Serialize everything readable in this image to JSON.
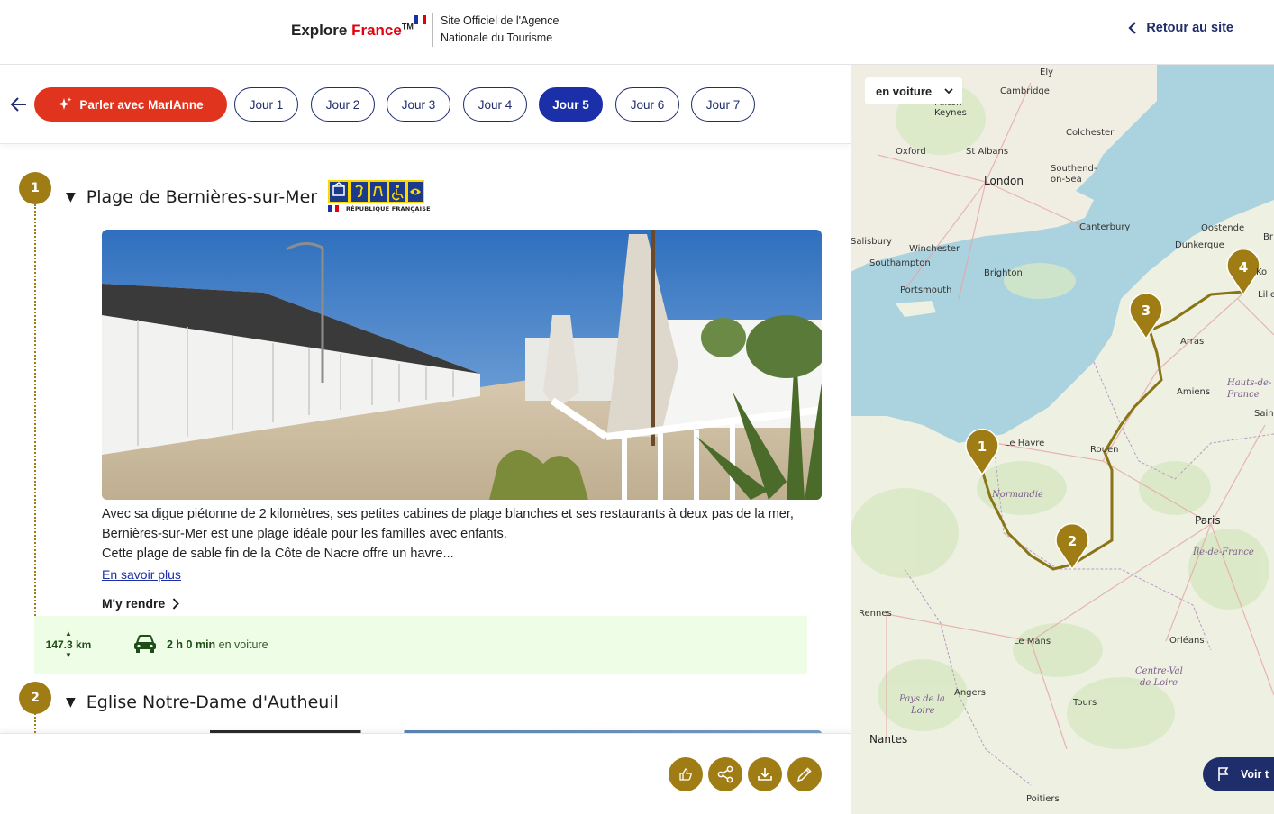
{
  "header": {
    "logo_main": "Explore",
    "logo_accent": "France",
    "logo_tm": "TM",
    "agency_line1": "Site Officiel de l'Agence",
    "agency_line2": "Nationale du Tourisme",
    "back_to_site": "Retour au site",
    "flag_colors": [
      "#1b2fa8",
      "#ffffff",
      "#e1000f"
    ]
  },
  "toolbar": {
    "marianne_label": "Parler avec MarIAnne",
    "days": [
      "Jour 1",
      "Jour 2",
      "Jour 3",
      "Jour 4",
      "Jour 5",
      "Jour 6",
      "Jour 7"
    ],
    "active_day": "Jour 5"
  },
  "steps": [
    {
      "number": "1",
      "title": "Plage de Bernières-sur-Mer",
      "label_text": "RÉPUBLIQUE FRANÇAISE",
      "description": "Avec sa digue piétonne de 2 kilomètres, ses petites cabines de plage blanches et ses restaurants à deux pas de la mer, Bernières-sur-Mer est une plage idéale pour les familles avec enfants.",
      "description2": "Cette plage de sable fin de la Côte de Nacre offre un havre...",
      "more_link": "En savoir plus",
      "goto": "M'y rendre"
    },
    {
      "number": "2",
      "title": "Eglise Notre-Dame d'Autheuil"
    }
  ],
  "route": {
    "distance": "147.3 km",
    "duration": "2 h 0 min",
    "mode": "en voiture"
  },
  "actions": [
    "thumbs-up",
    "share",
    "download",
    "edit"
  ],
  "map": {
    "mode": "en voiture",
    "voir_button": "Voir t",
    "cities": [
      "Ely",
      "Cambridge",
      "Milton",
      "Keynes",
      "Colchester",
      "Oxford",
      "St Albans",
      "London",
      "Southend-",
      "on-Sea",
      "Canterbury",
      "Oostende",
      "Br",
      "Salisbury",
      "Winchester",
      "Dunkerque",
      "Ko",
      "Southampton",
      "Brighton",
      "Lille",
      "Portsmouth",
      "Arras",
      "Hauts-de-",
      "France",
      "Amiens",
      "Sain",
      "Le Havre",
      "Rouen",
      "Normandie",
      "Paris",
      "Île-de-France",
      "Rennes",
      "Le Mans",
      "Orléans",
      "Centre-Val",
      "de Loire",
      "Pays de la",
      "Loire",
      "Angers",
      "Tours",
      "Nantes",
      "Poitiers"
    ],
    "markers": [
      "1",
      "2",
      "3",
      "4"
    ],
    "route_color": "#8a7418",
    "marker_color": "#a07d14"
  }
}
